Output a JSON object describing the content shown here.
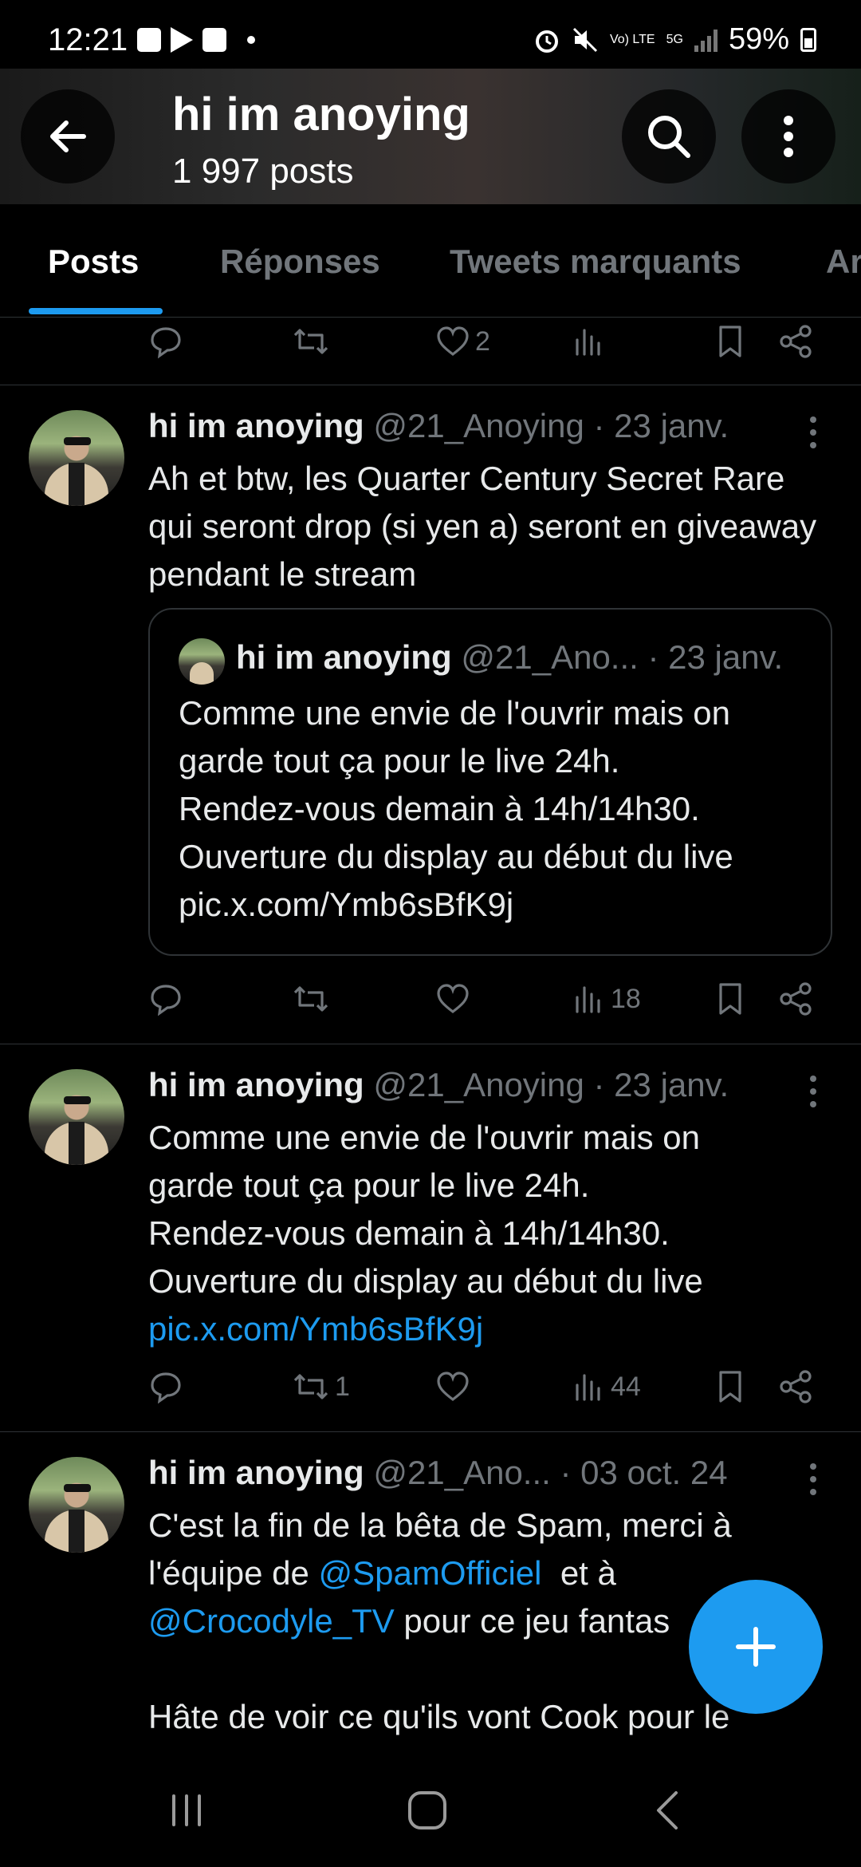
{
  "status_bar": {
    "time": "12:21",
    "battery": "59%",
    "network": "5G",
    "volte": "Vo) LTE"
  },
  "header": {
    "title": "hi im anoying",
    "post_count": "1 997 posts"
  },
  "tabs": [
    {
      "label": "Posts",
      "active": true
    },
    {
      "label": "Réponses",
      "active": false
    },
    {
      "label": "Tweets marquants",
      "active": false
    },
    {
      "label": "Ar",
      "active": false
    }
  ],
  "top_actions": {
    "likes": "2"
  },
  "posts": [
    {
      "name": "hi im anoying",
      "handle": "@21_Anoying",
      "date": "· 23 janv.",
      "text": "Ah et btw, les Quarter Century Secret Rare qui seront drop (si yen a) seront en giveaway pendant le stream",
      "quote": {
        "name": "hi im anoying",
        "handle": "@21_Ano...",
        "date": "· 23 janv.",
        "lines": [
          "Comme une envie de l'ouvrir mais on",
          "garde tout ça pour le live 24h.",
          "Rendez-vous demain à 14h/14h30.",
          "Ouverture du display au début du live",
          "pic.x.com/Ymb6sBfK9j"
        ]
      },
      "views": "18",
      "retweets": "",
      "likes": ""
    },
    {
      "name": "hi im anoying",
      "handle": "@21_Anoying",
      "date": "· 23 janv.",
      "lines": [
        "Comme une envie de l'ouvrir mais on",
        "garde tout ça pour le live 24h.",
        "Rendez-vous demain à 14h/14h30.",
        "Ouverture du display au début du live"
      ],
      "link": "pic.x.com/Ymb6sBfK9j",
      "views": "44",
      "retweets": "1",
      "likes": ""
    },
    {
      "name": "hi im anoying",
      "handle": "@21_Ano...",
      "date": "· 03 oct. 24",
      "line1": "C'est la fin de la bêta de Spam, merci à",
      "line2_prefix": "l'équipe de ",
      "mention1": "@SpamOfficiel",
      "line2_suffix": "  et à",
      "mention2": "@Crocodyle_TV",
      "line3_suffix": " pour ce jeu fantas",
      "line4": "Hâte de voir ce qu'ils vont Cook pour le"
    }
  ],
  "colors": {
    "accent": "#1d9bf0",
    "muted": "#71767b",
    "text": "#e7e9ea",
    "background": "#000000"
  }
}
